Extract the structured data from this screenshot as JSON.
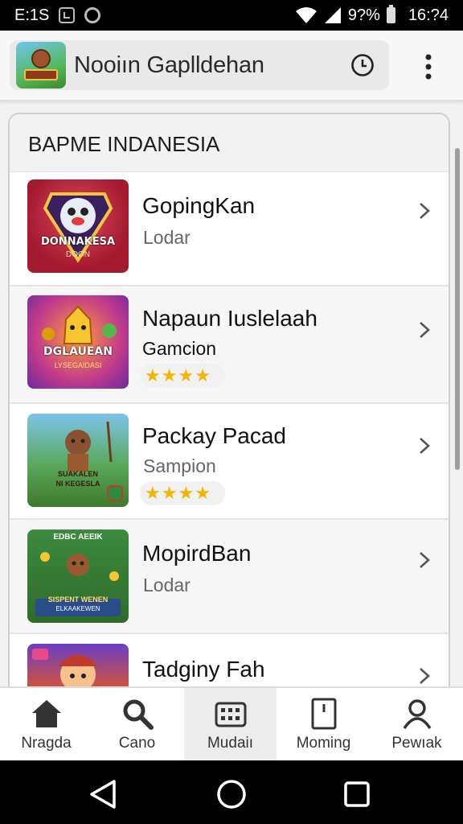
{
  "status_bar": {
    "left_text": "E:1S",
    "battery": "9?%",
    "time": "16:?4"
  },
  "app_bar": {
    "title": "Nooiın Gaplldehan",
    "clock_icon": "clock-icon",
    "menu_icon": "more-vert-icon"
  },
  "list": {
    "header": "BAPME INDANESIA",
    "items": [
      {
        "title": "GopingKan",
        "subtitle": "Lodar",
        "thumb_text": "DONNAKESA",
        "thumb_sub": "DOON"
      },
      {
        "title": "Napaun Iuslelaah",
        "subtitle": "Gamcion",
        "rating": 4,
        "thumb_text": "DGLAUEAN",
        "thumb_sub": "LYSEGAIDASI"
      },
      {
        "title": "Packay Pacad",
        "subtitle": "Sampion",
        "rating": 4,
        "thumb_text": "SUAKALEN",
        "thumb_sub": "NI KEGESLA"
      },
      {
        "title": "MopirdBan",
        "subtitle": "Lodar",
        "thumb_text": "SISPENT WENEN",
        "thumb_sub": "ELKAAKEWEN",
        "thumb_top": "EDBC AEEIK"
      },
      {
        "title": "Tadginy Fah",
        "subtitle": ""
      }
    ]
  },
  "bottom_nav": {
    "items": [
      {
        "label": "Nragda",
        "icon": "home-icon"
      },
      {
        "label": "Cano",
        "icon": "search-icon"
      },
      {
        "label": "Mudaiı",
        "icon": "keyboard-grid-icon"
      },
      {
        "label": "Moming",
        "icon": "tablet-icon"
      },
      {
        "label": "Pewıak",
        "icon": "person-icon"
      }
    ]
  },
  "colors": {
    "star": "#f4b400",
    "accent_green": "#1a8f3a"
  }
}
